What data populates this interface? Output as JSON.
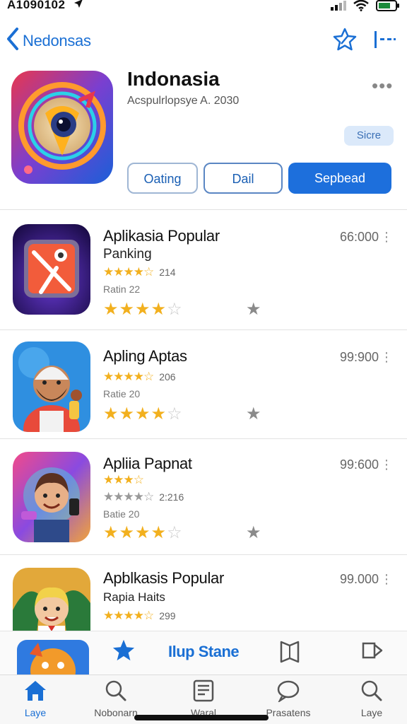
{
  "status_bar": {
    "time": "A1090102",
    "icons": [
      "location-arrow-icon",
      "signal-icon",
      "wifi-icon",
      "battery-icon"
    ]
  },
  "nav": {
    "back_label": "Nedonsas",
    "icons": [
      "star-outline-icon",
      "menu-dash-icon"
    ]
  },
  "header": {
    "title": "Indonasia",
    "subtitle": "Acspulrlopsye A. 2030",
    "more": "•••",
    "badge": "Sicre",
    "buttons": {
      "first": "Oating",
      "second": "Dail",
      "primary": "Sepbead"
    }
  },
  "apps": [
    {
      "name": "Aplikasia Popular",
      "subtitle": "Panking",
      "price": "66:000",
      "more": "⋮",
      "stars": "★★★★☆",
      "rating_count": "214",
      "rate_label": "Ratin 22",
      "big_stars": "★★★★",
      "big_empty": "☆",
      "fav": "★"
    },
    {
      "name": "Apling Aptas",
      "subtitle": "",
      "price": "99:900",
      "more": "⋮",
      "stars": "★★★★☆",
      "rating_count": "206",
      "rate_label": "Ratie 20",
      "big_stars": "★★★★",
      "big_empty": "☆",
      "fav": "★"
    },
    {
      "name": "Apliia Papnat",
      "subtitle": "",
      "price": "99:600",
      "more": "⋮",
      "stars": "★★★☆",
      "stars_second": "★★★★☆",
      "rating_count": "2:216",
      "rate_label": "Batie 20",
      "big_stars": "★★★★",
      "big_empty": "☆",
      "fav": "★"
    },
    {
      "name": "Apblkasis Popular",
      "subtitle": "Rapia Haits",
      "price": "99.000",
      "more": "⋮",
      "stars": "★★★★☆",
      "rating_count": "299"
    }
  ],
  "mini_bar": {
    "title": "Ilup Stane"
  },
  "tabs": [
    {
      "label": "Laye",
      "icon": "home-icon",
      "active": true
    },
    {
      "label": "Nobonarn",
      "icon": "search-icon",
      "active": false
    },
    {
      "label": "Waral",
      "icon": "list-icon",
      "active": false
    },
    {
      "label": "Prasatens",
      "icon": "chat-icon",
      "active": false
    },
    {
      "label": "Laye",
      "icon": "search-icon",
      "active": false
    }
  ],
  "colors": {
    "accent": "#1d6fdc",
    "star": "#f2b01e",
    "badge_bg": "#dbe9fa"
  }
}
